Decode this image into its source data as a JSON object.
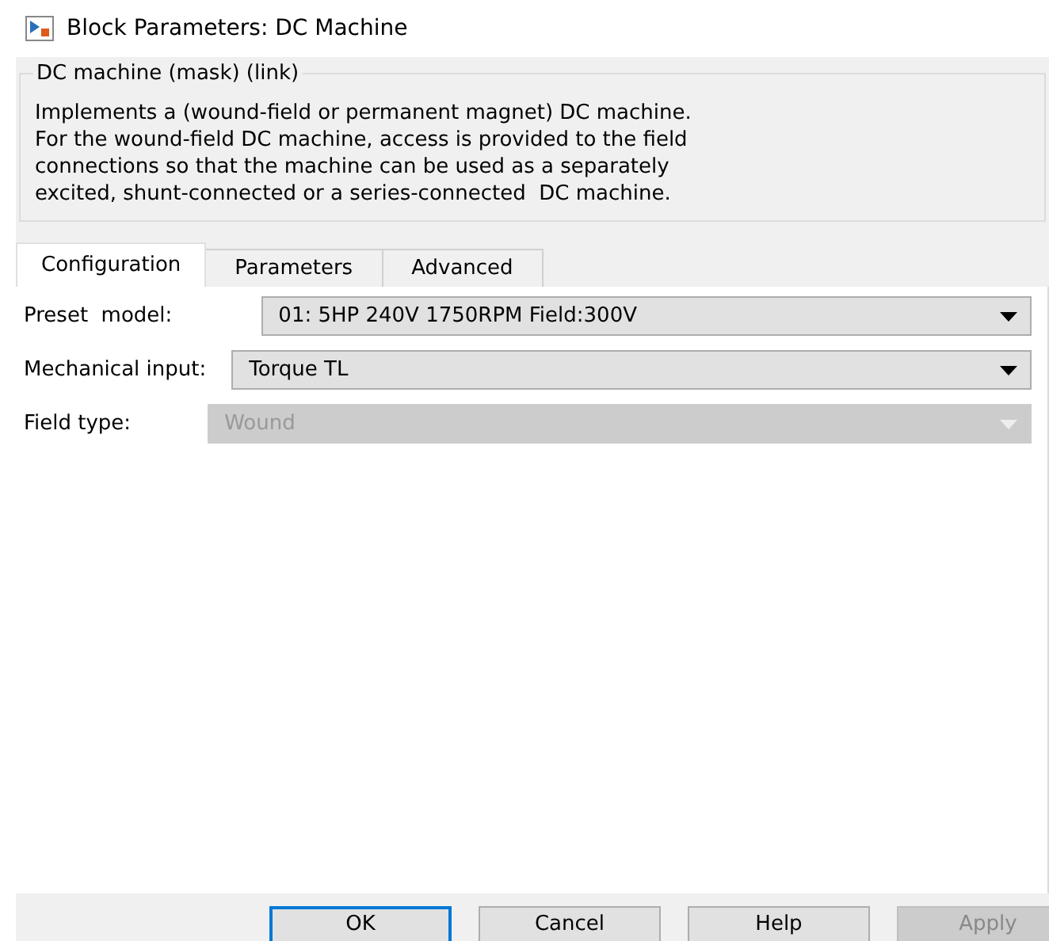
{
  "window": {
    "title": "Block Parameters: DC Machine"
  },
  "group": {
    "title": "DC machine (mask) (link)",
    "description": "Implements a (wound-field or permanent magnet) DC machine.\nFor the wound-field DC machine, access is provided to the field\nconnections so that the machine can be used as a separately\nexcited, shunt-connected or a series-connected  DC machine."
  },
  "tabs": [
    {
      "label": "Configuration",
      "selected": true
    },
    {
      "label": "Parameters",
      "selected": false
    },
    {
      "label": "Advanced",
      "selected": false
    }
  ],
  "fields": [
    {
      "label": "Preset  model:",
      "value": "01: 5HP 240V 1750RPM Field:300V",
      "disabled": false
    },
    {
      "label": "Mechanical input:",
      "value": "Torque TL",
      "disabled": false
    },
    {
      "label": "Field type:",
      "value": "Wound",
      "disabled": true
    }
  ],
  "buttons": [
    {
      "label": "OK",
      "default": true,
      "disabled": false
    },
    {
      "label": "Cancel",
      "default": false,
      "disabled": false
    },
    {
      "label": "Help",
      "default": false,
      "disabled": false
    },
    {
      "label": "Apply",
      "default": false,
      "disabled": true
    }
  ]
}
